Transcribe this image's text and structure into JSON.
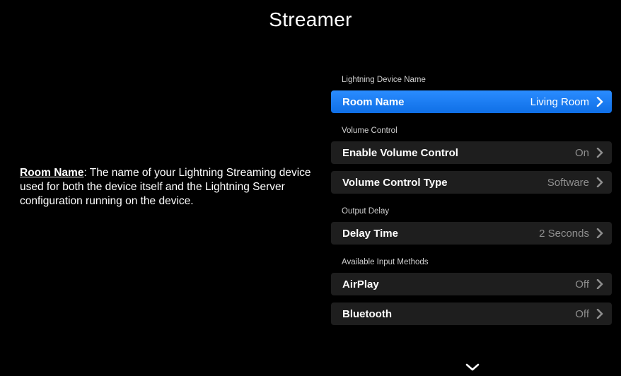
{
  "header": {
    "title": "Streamer"
  },
  "description": {
    "term": "Room Name",
    "text": ": The name of your Lightning Streaming device used for both the device itself and the Lightning Server configuration running on the device."
  },
  "sections": [
    {
      "header": "Lightning Device Name",
      "rows": [
        {
          "label": "Room Name",
          "value": "Living Room",
          "selected": true
        }
      ]
    },
    {
      "header": "Volume Control",
      "rows": [
        {
          "label": "Enable Volume Control",
          "value": "On"
        },
        {
          "label": "Volume Control Type",
          "value": "Software"
        }
      ]
    },
    {
      "header": "Output Delay",
      "rows": [
        {
          "label": "Delay Time",
          "value": "2 Seconds"
        }
      ]
    },
    {
      "header": "Available Input Methods",
      "rows": [
        {
          "label": "AirPlay",
          "value": "Off"
        },
        {
          "label": "Bluetooth",
          "value": "Off"
        }
      ]
    }
  ],
  "icons": {
    "row_chevron": "chevron-right-icon",
    "scroll": "chevron-down-icon"
  },
  "colors": {
    "background": "#000000",
    "selected_row": "#1a7df5",
    "row": "#1e1e1e",
    "value_text": "#8f8f8f"
  }
}
